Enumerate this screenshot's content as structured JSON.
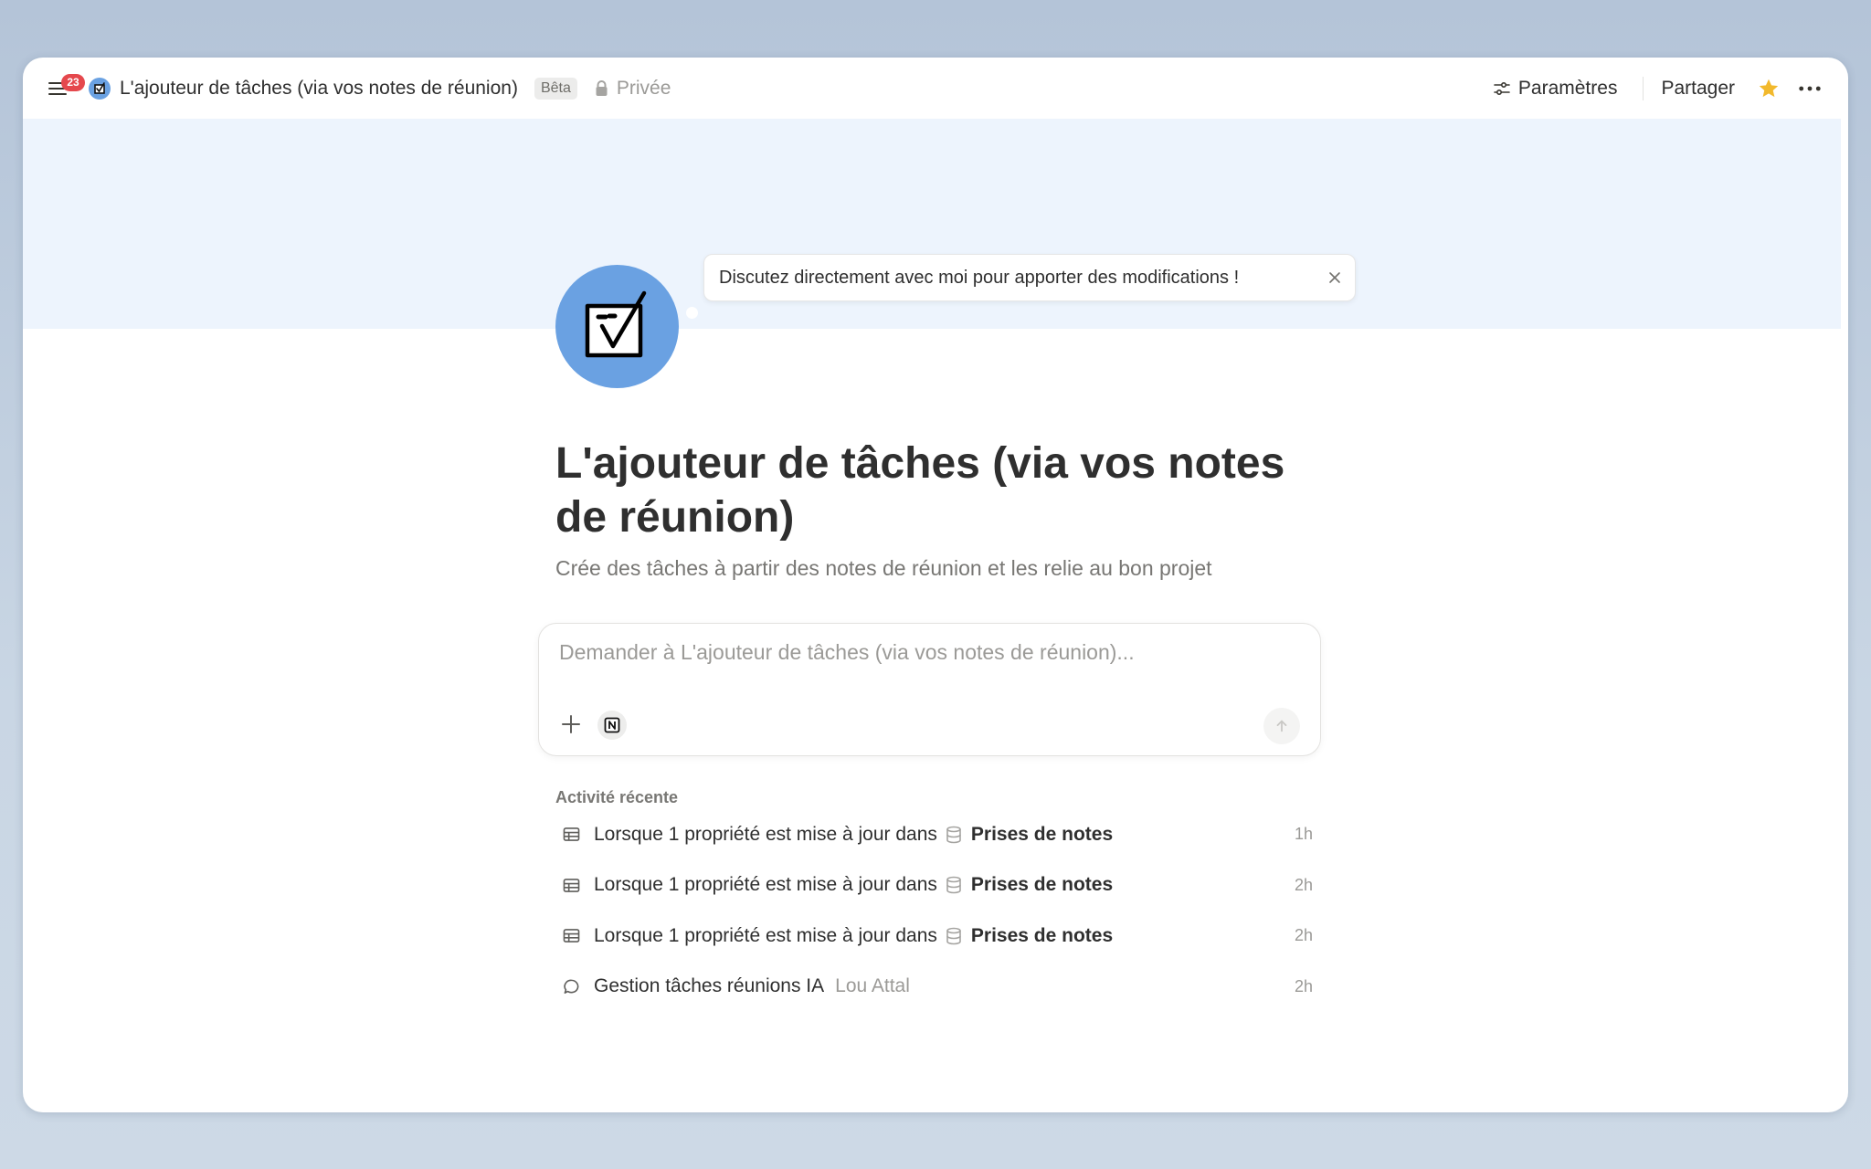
{
  "topbar": {
    "notification_count": "23",
    "page_title": "L'ajouteur de tâches (via vos notes de réunion)",
    "beta_label": "Bêta",
    "privacy_label": "Privée",
    "settings_label": "Paramètres",
    "share_label": "Partager",
    "icons": {
      "menu": "menu-icon",
      "page": "checkbox-icon",
      "lock": "lock-icon",
      "settings": "sliders-icon",
      "favorite": "star-icon",
      "more": "more-horizontal-icon"
    },
    "star_color": "#f2b92c"
  },
  "banner": {
    "tooltip_text": "Discutez directement avec moi pour apporter des modifications !",
    "color": "#edf4fd"
  },
  "agent": {
    "title": "L'ajouteur de tâches (via vos notes de réunion)",
    "description": "Crée des tâches à partir des notes de réunion et les relie au bon projet",
    "avatar_color": "#6aa1e2"
  },
  "composer": {
    "placeholder": "Demander à L'ajouteur de tâches (via vos notes de réunion)...",
    "value": ""
  },
  "recent": {
    "heading": "Activité récente",
    "items": [
      {
        "icon": "table-icon",
        "text": "Lorsque 1 propriété est mise à jour dans",
        "db_icon": "database-icon",
        "target": "Prises de notes",
        "time": "1h"
      },
      {
        "icon": "table-icon",
        "text": "Lorsque 1 propriété est mise à jour dans",
        "db_icon": "database-icon",
        "target": "Prises de notes",
        "time": "2h"
      },
      {
        "icon": "table-icon",
        "text": "Lorsque 1 propriété est mise à jour dans",
        "db_icon": "database-icon",
        "target": "Prises de notes",
        "time": "2h"
      },
      {
        "icon": "chat-bubble-icon",
        "text": "Gestion tâches réunions IA",
        "author": "Lou Attal",
        "time": "2h"
      }
    ]
  }
}
